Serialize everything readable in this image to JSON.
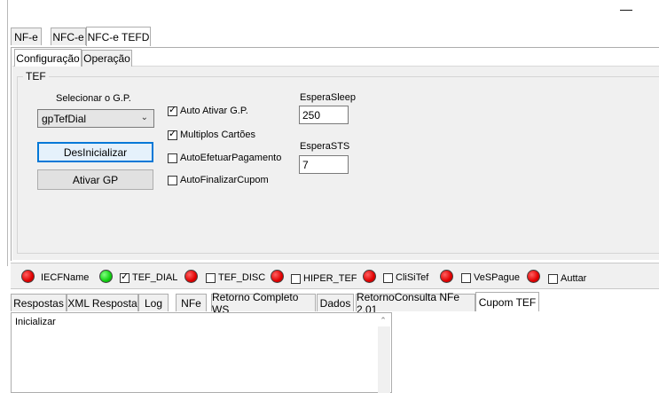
{
  "window": {
    "minimize_label": "—"
  },
  "main_tabs": [
    {
      "label": "NF-e",
      "active": false
    },
    {
      "label": "NFC-e",
      "active": false
    },
    {
      "label": "NFC-e TEFD",
      "active": true
    }
  ],
  "sub_tabs": [
    {
      "label": "Configuração",
      "active": true
    },
    {
      "label": "Operação",
      "active": false
    }
  ],
  "tef": {
    "group_title": "TEF",
    "select_gp_label": "Selecionar o G.P.",
    "select_gp_value": "gpTefDial",
    "btn_desinicializar": "DesInicializar",
    "btn_ativar_gp": "Ativar GP",
    "checkboxes": [
      {
        "label": "Auto Ativar G.P.",
        "checked": true
      },
      {
        "label": "Multiplos Cartões",
        "checked": true
      },
      {
        "label": "AutoEfetuarPagamento",
        "checked": false
      },
      {
        "label": "AutoFinalizarCupom",
        "checked": false
      }
    ],
    "espera_sleep_label": "EsperaSleep",
    "espera_sleep_value": "250",
    "espera_sts_label": "EsperaSTS",
    "espera_sts_value": "7"
  },
  "status": {
    "items": [
      {
        "label": "IECFName",
        "led": "red",
        "has_checkbox": false,
        "checked": false
      },
      {
        "label": "TEF_DIAL",
        "led": "green",
        "has_checkbox": true,
        "checked": true
      },
      {
        "label": "TEF_DISC",
        "led": "red",
        "has_checkbox": true,
        "checked": false
      },
      {
        "label": "HIPER_TEF",
        "led": "red",
        "has_checkbox": true,
        "checked": false
      },
      {
        "label": "CliSiTef",
        "led": "red",
        "has_checkbox": true,
        "checked": false
      },
      {
        "label": "VeSPague",
        "led": "red",
        "has_checkbox": true,
        "checked": false
      },
      {
        "label": "Auttar",
        "led": "red",
        "has_checkbox": true,
        "checked": false
      }
    ],
    "colors": {
      "red": "#e00000",
      "green": "#10d010"
    }
  },
  "bottom_tabs": [
    {
      "label": "Respostas",
      "active": false
    },
    {
      "label": "XML Resposta",
      "active": false
    },
    {
      "label": "Log",
      "active": false
    },
    {
      "label": "NFe",
      "active": false
    },
    {
      "label": "Retorno Completo WS",
      "active": false
    },
    {
      "label": "Dados",
      "active": false
    },
    {
      "label": "RetornoConsulta NFe 2.01",
      "active": false
    },
    {
      "label": "Cupom TEF",
      "active": true
    }
  ],
  "memo": {
    "text": "Inicializar"
  }
}
